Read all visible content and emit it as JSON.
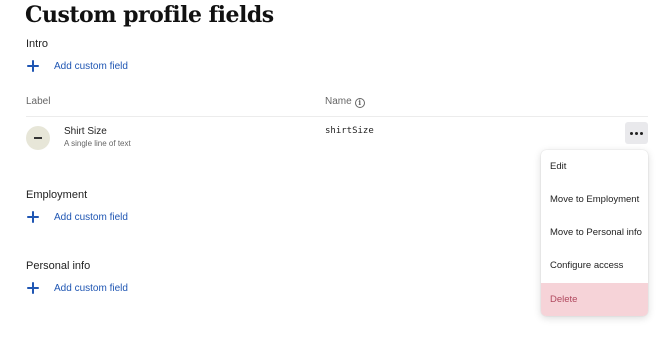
{
  "page": {
    "title": "Custom profile fields"
  },
  "sections": {
    "intro": {
      "heading": "Intro",
      "add_label": "Add custom field"
    },
    "employment": {
      "heading": "Employment",
      "add_label": "Add custom field"
    },
    "personal_info": {
      "heading": "Personal info",
      "add_label": "Add custom field"
    }
  },
  "table": {
    "columns": {
      "label": "Label",
      "name": "Name"
    },
    "rows": [
      {
        "label": "Shirt Size",
        "description": "A single line of text",
        "name": "shirtSize"
      }
    ]
  },
  "menu": {
    "items": [
      {
        "label": "Edit"
      },
      {
        "label": "Move to Employment"
      },
      {
        "label": "Move to Personal info"
      },
      {
        "label": "Configure access"
      },
      {
        "label": "Delete"
      }
    ]
  },
  "colors": {
    "link": "#1f56b3",
    "danger_bg": "#f6d3d8",
    "danger_text": "#b0485e"
  },
  "icons": {
    "add": "plus-icon",
    "remove": "minus-icon",
    "info": "info-icon",
    "more": "more-horizontal-icon"
  }
}
